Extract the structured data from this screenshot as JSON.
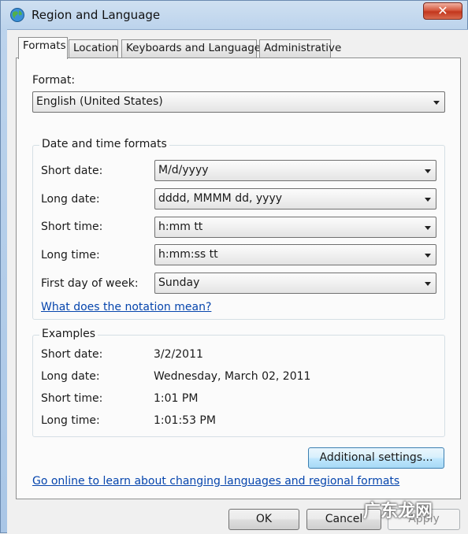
{
  "window": {
    "title": "Region and Language",
    "close_glyph": "✕"
  },
  "tabs": [
    {
      "label": "Formats",
      "active": true
    },
    {
      "label": "Location",
      "active": false
    },
    {
      "label": "Keyboards and Languages",
      "active": false
    },
    {
      "label": "Administrative",
      "active": false
    }
  ],
  "format": {
    "label": "Format:",
    "value": "English (United States)"
  },
  "date_time_formats": {
    "title": "Date and time formats",
    "rows": [
      {
        "label": "Short date:",
        "value": "M/d/yyyy"
      },
      {
        "label": "Long date:",
        "value": "dddd, MMMM dd, yyyy"
      },
      {
        "label": "Short time:",
        "value": "h:mm tt"
      },
      {
        "label": "Long time:",
        "value": "h:mm:ss tt"
      },
      {
        "label": "First day of week:",
        "value": "Sunday"
      }
    ],
    "notation_link": "What does the notation mean?"
  },
  "examples": {
    "title": "Examples",
    "rows": [
      {
        "label": "Short date:",
        "value": "3/2/2011"
      },
      {
        "label": "Long date:",
        "value": "Wednesday, March 02, 2011"
      },
      {
        "label": "Short time:",
        "value": "1:01 PM"
      },
      {
        "label": "Long time:",
        "value": "1:01:53 PM"
      }
    ]
  },
  "additional_settings_label": "Additional settings...",
  "online_link": "Go online to learn about changing languages and regional formats",
  "buttons": {
    "ok": "OK",
    "cancel": "Cancel",
    "apply": "Apply"
  },
  "watermark": "广东龙网",
  "colors": {
    "link": "#0645ad",
    "close_button": "#c3361d",
    "title_bar": "#bcd3ec"
  },
  "icons": {
    "title_icon": "globe-icon",
    "combo_arrow": "chevron-down-icon",
    "close": "close-icon"
  }
}
